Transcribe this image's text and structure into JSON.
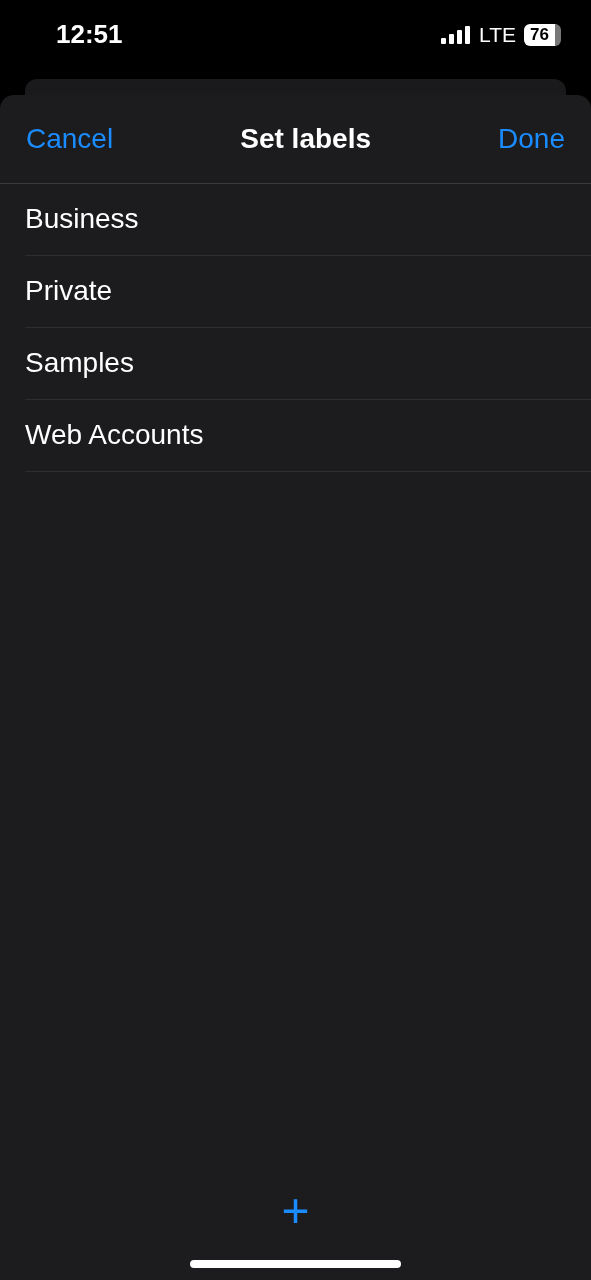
{
  "status_bar": {
    "time": "12:51",
    "network": "LTE",
    "battery": "76"
  },
  "nav_bar": {
    "cancel": "Cancel",
    "title": "Set labels",
    "done": "Done"
  },
  "labels": [
    {
      "name": "Business"
    },
    {
      "name": "Private"
    },
    {
      "name": "Samples"
    },
    {
      "name": "Web Accounts"
    }
  ],
  "add_button": {
    "icon": "+"
  }
}
